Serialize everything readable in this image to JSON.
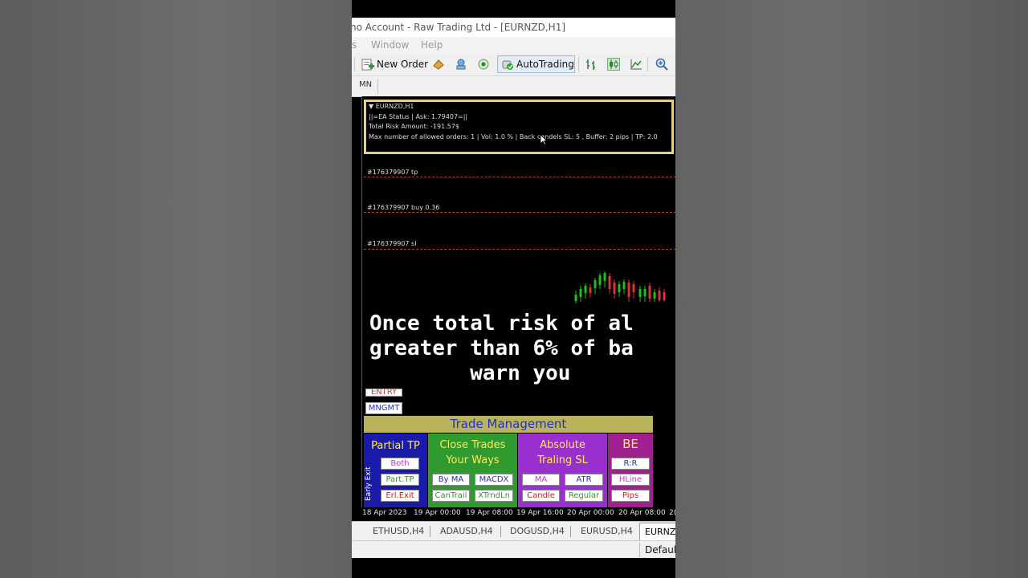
{
  "window": {
    "title": "no Account - Raw Trading Ltd - [EURNZD,H1]"
  },
  "menu": [
    "s",
    "Window",
    "Help"
  ],
  "toolbar": {
    "new_order_label": "New Order",
    "autotrading_label": "AutoTrading"
  },
  "timeframes": {
    "visible": "MN"
  },
  "info_panel": {
    "symbol_line": "EURNZD,H1",
    "status_line": "||=EA Status | Ask: 1.79407=||",
    "risk_line": "Total Risk Amount: -191.57$",
    "params_line": "Max number of allowed orders: 1 | Vol: 1.0 % | Back candels SL: 5 , Buffer: 2 pips | TP: 2.0"
  },
  "order_lines": [
    {
      "label": "#176379907 tp",
      "color": "#c0392b"
    },
    {
      "label": "#176379907 buy 0.36",
      "color": "#b44444"
    },
    {
      "label": "#176379907 sl",
      "color": "#c0392b"
    }
  ],
  "caption": {
    "line1": "Once total risk of al",
    "line2": "greater than 6% of ba",
    "line3": "        warn you"
  },
  "side_buttons": {
    "entry": "ENTRY",
    "mngmt": "MNGMT"
  },
  "trade_management": {
    "title": "Trade Management",
    "early_exit": "Early Exit",
    "partial_tp": {
      "title": "Partial TP",
      "buttons": [
        "Both",
        "Part.TP",
        "Erl.Exit"
      ]
    },
    "close_trades": {
      "title_line1": "Close Trades",
      "title_line2": "Your Ways",
      "buttons": [
        "By MA",
        "MACDX",
        "CanTrail",
        "XTrndLn"
      ]
    },
    "absolute_sl": {
      "title_line1": "Absolute",
      "title_line2": "Traling SL",
      "buttons": [
        "MA",
        "ATR",
        "Candle",
        "Regular"
      ]
    },
    "be": {
      "title": "BE",
      "buttons": [
        "R:R",
        "HLine",
        "Pips"
      ]
    }
  },
  "time_axis": [
    "18 Apr 2023",
    "19 Apr 00:00",
    "19 Apr 08:00",
    "19 Apr 16:00",
    "20 Apr 00:00",
    "20 Apr 08:00",
    "2("
  ],
  "chart_tabs": [
    "ETHUSD,H4",
    "ADAUSD,H4",
    "DOGUSD,H4",
    "EURUSD,H4",
    "EURNZ"
  ],
  "status": {
    "profile": "Default"
  },
  "colors": {
    "partial_tp_bg": "#1a1aa8",
    "close_trades_bg": "#2f9a2f",
    "absolute_sl_bg": "#9a2fd0",
    "be_bg": "#a0208f",
    "header_bg": "#b9b35c",
    "info_border": "#e6d27a"
  }
}
